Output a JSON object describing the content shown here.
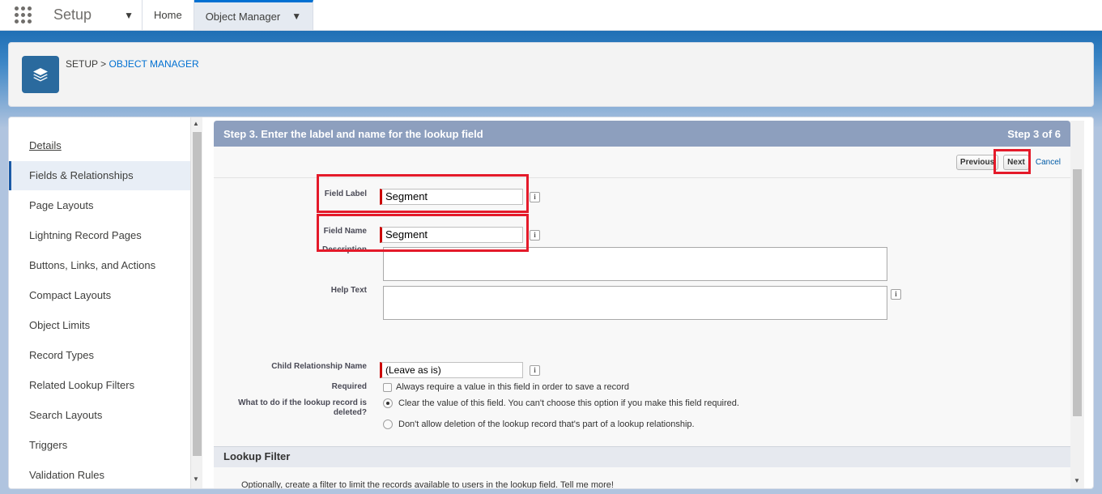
{
  "topbar": {
    "app_name": "Setup",
    "tabs": [
      {
        "label": "Home"
      },
      {
        "label": "Object Manager"
      }
    ]
  },
  "breadcrumb": {
    "root": "SETUP",
    "separator": ">",
    "current": "OBJECT MANAGER"
  },
  "sidebar": {
    "items": [
      {
        "label": "Details"
      },
      {
        "label": "Fields & Relationships"
      },
      {
        "label": "Page Layouts"
      },
      {
        "label": "Lightning Record Pages"
      },
      {
        "label": "Buttons, Links, and Actions"
      },
      {
        "label": "Compact Layouts"
      },
      {
        "label": "Object Limits"
      },
      {
        "label": "Record Types"
      },
      {
        "label": "Related Lookup Filters"
      },
      {
        "label": "Search Layouts"
      },
      {
        "label": "Triggers"
      },
      {
        "label": "Validation Rules"
      }
    ]
  },
  "step": {
    "title": "Step 3. Enter the label and name for the lookup field",
    "progress": "Step 3 of 6"
  },
  "buttons": {
    "previous": "Previous",
    "next": "Next",
    "cancel": "Cancel"
  },
  "form": {
    "field_label": {
      "label": "Field Label",
      "value": "Segment"
    },
    "field_name": {
      "label": "Field Name",
      "value": "Segment"
    },
    "description": {
      "label": "Description"
    },
    "help_text": {
      "label": "Help Text"
    },
    "child_relationship": {
      "label": "Child Relationship Name",
      "value": "(Leave as is)"
    },
    "required": {
      "label": "Required",
      "option": "Always require a value in this field in order to save a record"
    },
    "delete_behavior": {
      "label_line1": "What to do if the lookup record is",
      "label_line2": "deleted?",
      "option_clear": "Clear the value of this field. You can't choose this option if you make this field required.",
      "option_prevent": "Don't allow deletion of the lookup record that's part of a lookup relationship."
    },
    "info_glyph": "i"
  },
  "lookup_filter": {
    "title": "Lookup Filter",
    "text": "Optionally, create a filter to limit the records available to users in the lookup field.  Tell me more!"
  },
  "colors": {
    "brand_blue": "#0070d2",
    "step_header": "#8d9fbe",
    "highlight_red": "#e41a2a",
    "required_red": "#cc0000"
  }
}
